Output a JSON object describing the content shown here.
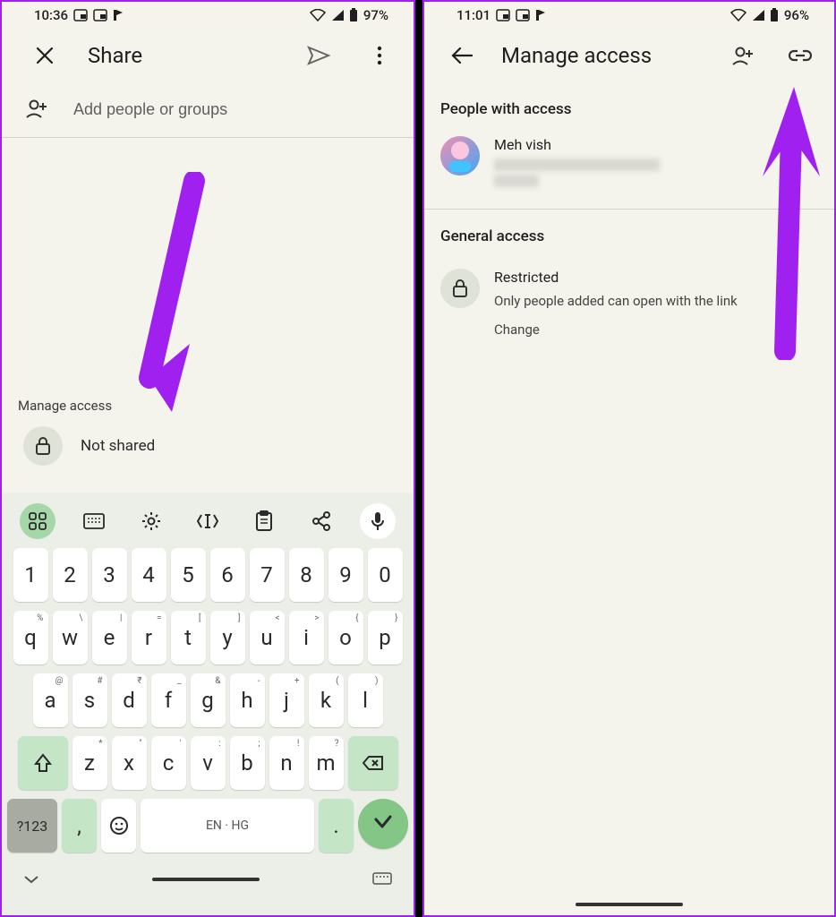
{
  "left": {
    "status": {
      "time": "10:36",
      "battery": "97%"
    },
    "header": {
      "title": "Share"
    },
    "input": {
      "placeholder": "Add people or groups"
    },
    "manage": {
      "label": "Manage access",
      "status": "Not shared"
    },
    "keyboard": {
      "row1": [
        "1",
        "2",
        "3",
        "4",
        "5",
        "6",
        "7",
        "8",
        "9",
        "0"
      ],
      "row2": [
        {
          "k": "q",
          "s": "%"
        },
        {
          "k": "w",
          "s": "\\"
        },
        {
          "k": "e",
          "s": "|"
        },
        {
          "k": "r",
          "s": "="
        },
        {
          "k": "t",
          "s": "["
        },
        {
          "k": "y",
          "s": "]"
        },
        {
          "k": "u",
          "s": "<"
        },
        {
          "k": "i",
          "s": ">"
        },
        {
          "k": "o",
          "s": "{"
        },
        {
          "k": "p",
          "s": "}"
        }
      ],
      "row3": [
        {
          "k": "a",
          "s": "@"
        },
        {
          "k": "s",
          "s": "#"
        },
        {
          "k": "d",
          "s": "₹"
        },
        {
          "k": "f",
          "s": "_"
        },
        {
          "k": "g",
          "s": "&"
        },
        {
          "k": "h",
          "s": "-"
        },
        {
          "k": "j",
          "s": "+"
        },
        {
          "k": "k",
          "s": "("
        },
        {
          "k": "l",
          "s": ")"
        }
      ],
      "row4": [
        {
          "k": "z",
          "s": "*"
        },
        {
          "k": "x",
          "s": "\""
        },
        {
          "k": "c",
          "s": "'"
        },
        {
          "k": "v",
          "s": ":"
        },
        {
          "k": "b",
          "s": ";"
        },
        {
          "k": "n",
          "s": "!"
        },
        {
          "k": "m",
          "s": "?"
        }
      ],
      "symKey": "?123",
      "space": "EN · HG"
    }
  },
  "right": {
    "status": {
      "time": "11:01",
      "battery": "96%"
    },
    "header": {
      "title": "Manage access"
    },
    "people": {
      "heading": "People with access",
      "name": "Meh vish"
    },
    "general": {
      "heading": "General access",
      "title": "Restricted",
      "subtitle": "Only people added can open with the link",
      "change": "Change"
    }
  }
}
